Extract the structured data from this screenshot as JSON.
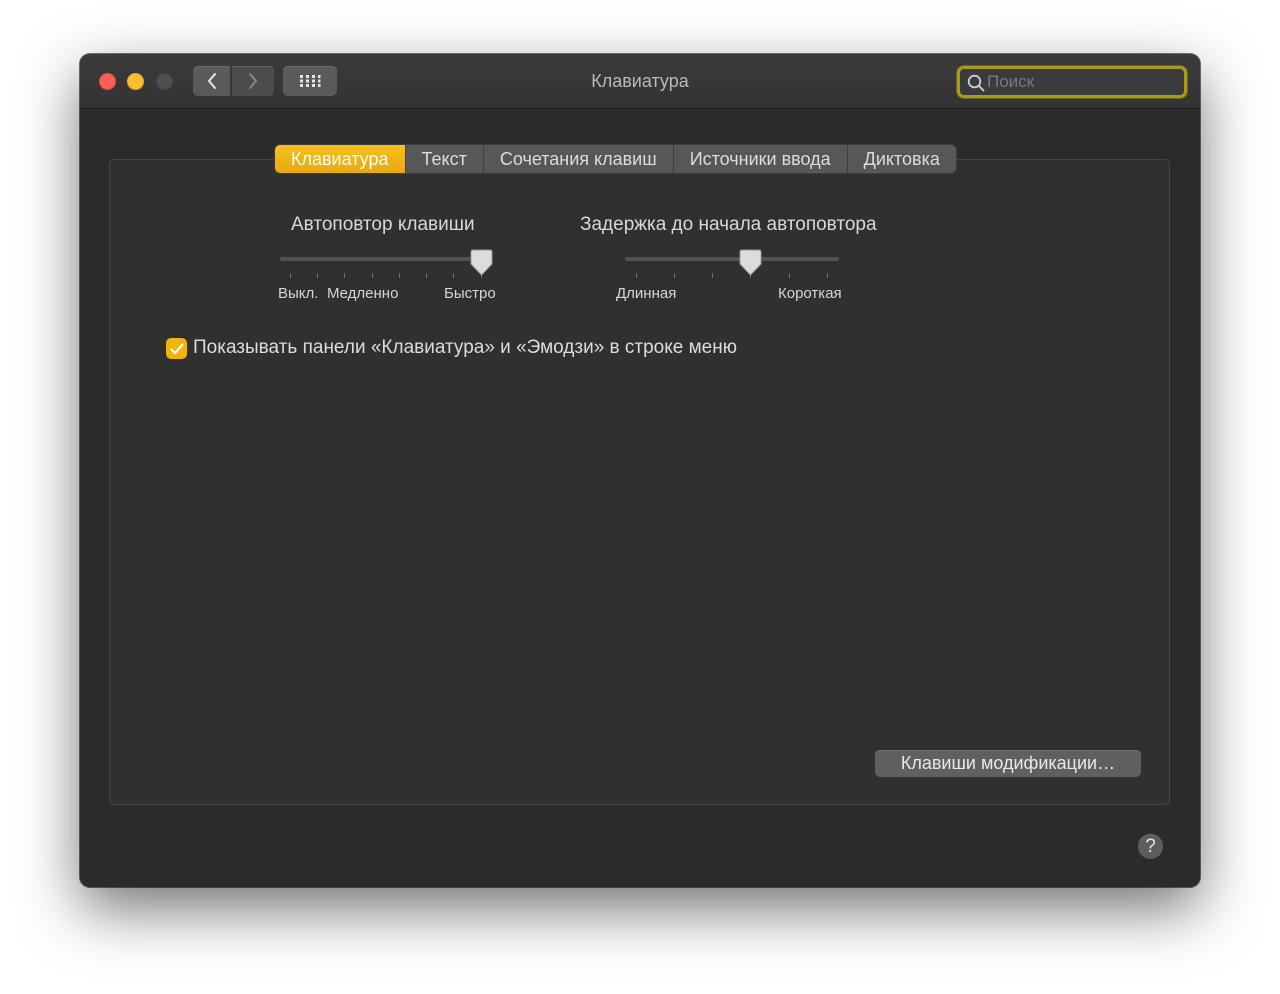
{
  "window": {
    "title": "Клавиатура"
  },
  "toolbar": {
    "search_placeholder": "Поиск"
  },
  "tabs": [
    {
      "label": "Клавиатура",
      "active": true
    },
    {
      "label": "Текст",
      "active": false
    },
    {
      "label": "Сочетания клавиш",
      "active": false
    },
    {
      "label": "Источники ввода",
      "active": false
    },
    {
      "label": "Диктовка",
      "active": false
    }
  ],
  "key_repeat": {
    "title": "Автоповтор клавиши",
    "labels": {
      "off": "Выкл.",
      "slow": "Медленно",
      "fast": "Быстро"
    },
    "ticks": 8,
    "selected_step": 8
  },
  "delay_until_repeat": {
    "title": "Задержка до начала автоповтора",
    "labels": {
      "long": "Длинная",
      "short": "Короткая"
    },
    "ticks": 6,
    "selected_step": 4
  },
  "show_menu_checkbox": {
    "label": "Показывать панели «Клавиатура» и «Эмодзи» в строке меню",
    "checked": true
  },
  "modifier_keys_button": "Клавиши модификации…",
  "help_button": "?",
  "colors": {
    "accent": "#f2b30f",
    "window_bg": "#2b2b2b"
  },
  "icons": [
    "back-chevron-icon",
    "forward-chevron-icon",
    "app-grid-icon",
    "search-icon",
    "checkmark-icon"
  ]
}
